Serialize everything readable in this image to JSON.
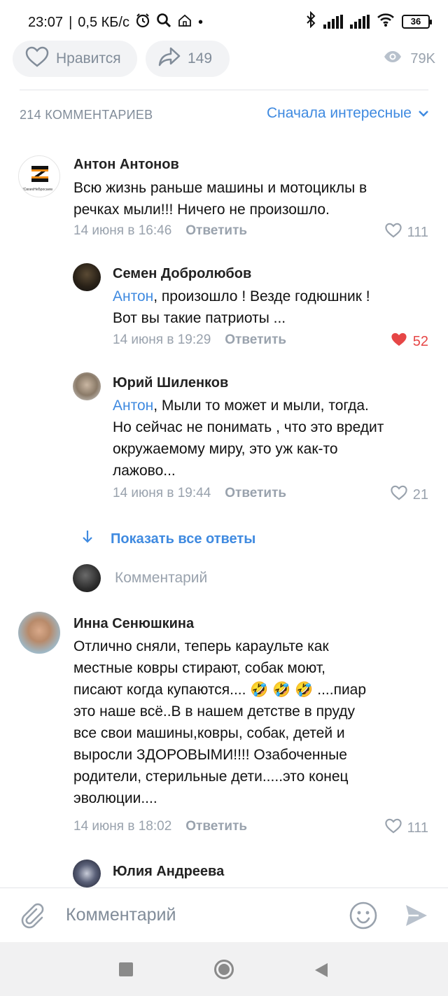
{
  "status_bar": {
    "time": "23:07",
    "speed": "0,5 КБ/с",
    "battery": "36",
    "icons": [
      "alarm-icon",
      "search-icon",
      "home-icon",
      "bluetooth-icon",
      "signal-icon",
      "wifi-icon",
      "battery-icon"
    ]
  },
  "post_actions": {
    "like_label": "Нравится",
    "share_count": "149",
    "views": "79K"
  },
  "comments_header": {
    "count_label": "214 КОММЕНТАРИЕВ",
    "sort_label": "Сначала интересные"
  },
  "comments": [
    {
      "author": "Антон Антонов",
      "avatar_text": "#СвоихНеБросаем",
      "lines": [
        "Всю жизнь раньше машины и мотоциклы в",
        "речках мыли!!! Ничего не произошло."
      ],
      "date": "14 июня в 16:46",
      "reply_label": "Ответить",
      "likes": "111",
      "liked": false
    },
    {
      "author": "Семен Добролюбов",
      "mention": "Антон",
      "lines": [
        ", произошло ! Везде годюшник !",
        "Вот вы такие патриоты ..."
      ],
      "date": "14 июня в 19:29",
      "reply_label": "Ответить",
      "likes": "52",
      "liked": true
    },
    {
      "author": "Юрий Шиленков",
      "mention": "Антон",
      "lines": [
        ", Мыли то может и мыли, тогда.",
        "Но сейчас не понимать , что это вредит",
        "окружаемому миру, это уж как-то",
        "лажово..."
      ],
      "date": "14 июня в 19:44",
      "reply_label": "Ответить",
      "likes": "21",
      "liked": false
    },
    {
      "author": "Инна Сенюшкина",
      "lines": [
        "Отлично сняли, теперь караульте как",
        "местные ковры стирают, собак моют,",
        "писают когда купаются.... 🤣 🤣 🤣 ....пиар",
        "это наше всё..В в нашем детстве в пруду",
        "все свои машины,ковры, собак, детей и",
        "выросли ЗДОРОВЫМИ!!!! Озабоченные",
        "родители, стерильные дети.....это конец",
        "эволюции...."
      ],
      "date": "14 июня в 18:02",
      "reply_label": "Ответить",
      "likes": "111",
      "liked": false
    },
    {
      "author": "Юлия Андреева"
    }
  ],
  "show_all_replies": "Показать все ответы",
  "reply_placeholder": "Комментарий",
  "composer": {
    "placeholder": "Комментарий"
  },
  "colors": {
    "accent": "#3f8ae0",
    "secondary_text": "#99a2ad",
    "liked_heart": "#e64646"
  }
}
